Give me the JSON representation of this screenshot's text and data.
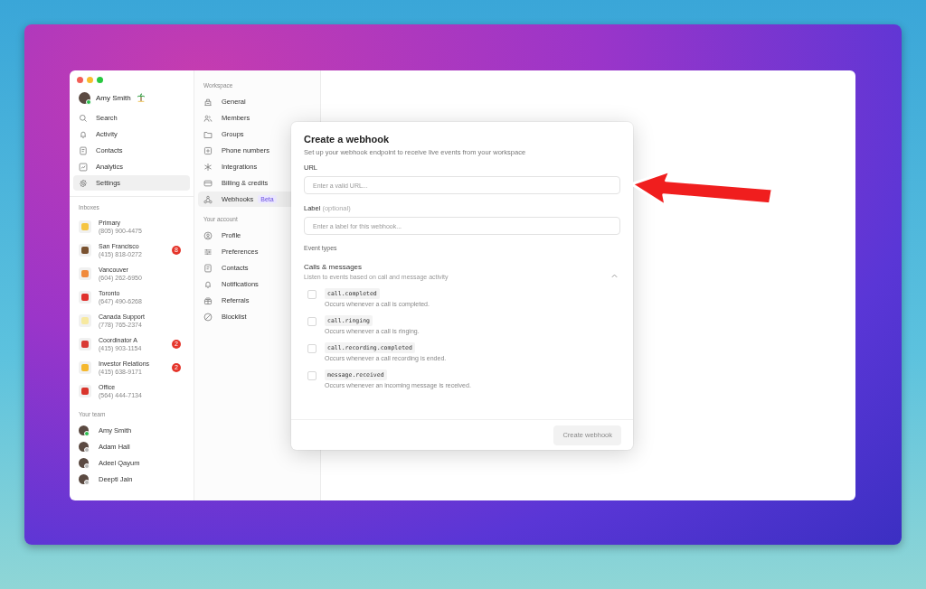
{
  "sidebar": {
    "user": {
      "name": "Amy Smith",
      "online": true
    },
    "nav": [
      {
        "label": "Search",
        "selected": false
      },
      {
        "label": "Activity",
        "selected": false
      },
      {
        "label": "Contacts",
        "selected": false
      },
      {
        "label": "Analytics",
        "selected": false
      },
      {
        "label": "Settings",
        "selected": true
      }
    ],
    "inboxes_heading": "Inboxes",
    "inboxes": [
      {
        "name": "Primary",
        "phone": "(805) 900-4475",
        "color": "#f5c542"
      },
      {
        "name": "San Francisco",
        "phone": "(415) 818-0272",
        "color": "#7a5230",
        "badge": "8"
      },
      {
        "name": "Vancouver",
        "phone": "(604) 262-6950",
        "color": "#f08a3c"
      },
      {
        "name": "Toronto",
        "phone": "(647) 490-6268",
        "color": "#e0312d"
      },
      {
        "name": "Canada Support",
        "phone": "(778) 765-2374",
        "color": "#f7e9a0"
      },
      {
        "name": "Coordinator A",
        "phone": "(415) 903-1154",
        "color": "#d93a35",
        "badge": "2"
      },
      {
        "name": "Investor Relations",
        "phone": "(415) 638-9171",
        "color": "#f5b82e",
        "badge": "2"
      },
      {
        "name": "Office",
        "phone": "(564) 444-7134",
        "color": "#d9342b"
      }
    ],
    "team_heading": "Your team",
    "team": [
      {
        "name": "Amy Smith",
        "online": true
      },
      {
        "name": "Adam Hall",
        "online": false
      },
      {
        "name": "Adeel Qayum",
        "online": false
      },
      {
        "name": "Deepti Jain",
        "online": false
      }
    ]
  },
  "settings_nav": {
    "sections": [
      {
        "heading": "Workspace",
        "items": [
          {
            "label": "General",
            "selected": false
          },
          {
            "label": "Members",
            "selected": false
          },
          {
            "label": "Groups",
            "selected": false
          },
          {
            "label": "Phone numbers",
            "selected": false
          },
          {
            "label": "Integrations",
            "selected": false
          },
          {
            "label": "Billing & credits",
            "selected": false
          },
          {
            "label": "Webhooks",
            "selected": true,
            "badge": "Beta"
          }
        ]
      },
      {
        "heading": "Your account",
        "items": [
          {
            "label": "Profile",
            "selected": false
          },
          {
            "label": "Preferences",
            "selected": false
          },
          {
            "label": "Contacts",
            "selected": false
          },
          {
            "label": "Notifications",
            "selected": false
          },
          {
            "label": "Referrals",
            "selected": false
          },
          {
            "label": "Blocklist",
            "selected": false
          }
        ]
      }
    ]
  },
  "modal": {
    "title": "Create a webhook",
    "subtitle": "Set up your webhook endpoint to receive live events from your workspace",
    "url_field": {
      "label": "URL",
      "placeholder": "Enter a valid URL..."
    },
    "label_field": {
      "label": "Label",
      "hint": "(optional)",
      "placeholder": "Enter a label for this webhook..."
    },
    "event_types_heading": "Event types",
    "group": {
      "title": "Calls & messages",
      "description": "Listen to events based on call and message activity",
      "expanded": true
    },
    "events": [
      {
        "name": "call.completed",
        "description": "Occurs whenever a call is completed.",
        "checked": false
      },
      {
        "name": "call.ringing",
        "description": "Occurs whenever a call is ringing.",
        "checked": false
      },
      {
        "name": "call.recording.completed",
        "description": "Occurs whenever a call recording is ended.",
        "checked": false
      },
      {
        "name": "message.received",
        "description": "Occurs whenever an incoming message is received.",
        "checked": false
      }
    ],
    "submit": {
      "label": "Create webhook",
      "disabled": true
    }
  }
}
